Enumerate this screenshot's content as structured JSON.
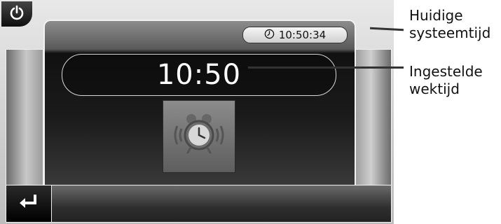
{
  "screen": {
    "system_time": "10:50:34",
    "wake_time": "10:50"
  },
  "icons": {
    "power": "power-icon",
    "clock": "clock-icon",
    "alarm": "alarm-clock-icon",
    "back": "back-arrow-icon"
  },
  "callouts": {
    "system_time_line1": "Huidige",
    "system_time_line2": "systeemtijd",
    "wake_time_line1": "Ingestelde",
    "wake_time_line2": "wektijd"
  }
}
